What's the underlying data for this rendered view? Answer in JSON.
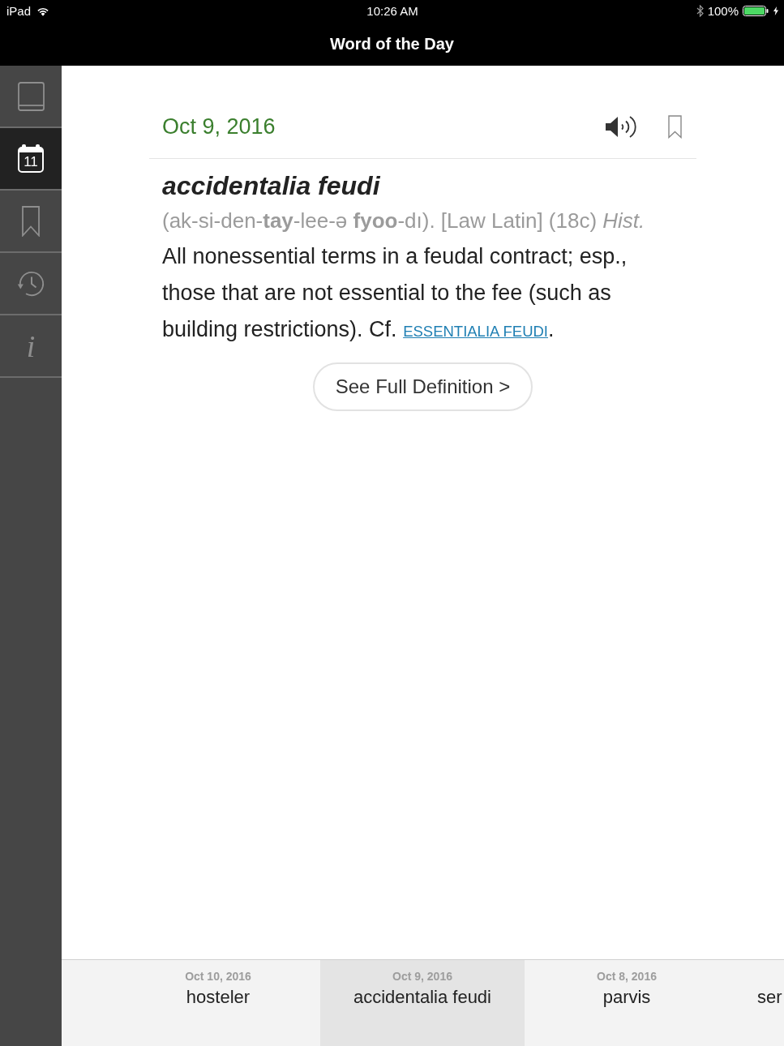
{
  "status_bar": {
    "carrier": "iPad",
    "time": "10:26 AM",
    "battery": "100%"
  },
  "nav_bar": {
    "title": "Word of the Day"
  },
  "sidebar": {
    "items": [
      {
        "kind": "book",
        "selected": false
      },
      {
        "kind": "calendar",
        "selected": true,
        "label": "11"
      },
      {
        "kind": "bookmark",
        "selected": false
      },
      {
        "kind": "history",
        "selected": false
      },
      {
        "kind": "info",
        "selected": false,
        "label": "i"
      }
    ]
  },
  "entry": {
    "date": "Oct 9, 2016",
    "bookmarked": false,
    "headword": "accidentalia feudi",
    "pronunciation": "(ak-si-den-**tay**-lee-ə **fyoo**-dı). [Law Latin] (18c) *Hist.*",
    "definition": "All nonessential terms in a feudal contract; esp., those that are not essential to the fee (such as building restrictions). Cf.",
    "cross_reference": "ESSENTIALIA FEUDI",
    "definition_end": ".",
    "button": "See Full Definition >"
  },
  "recent_words": [
    {
      "date": "Oct 10, 2016",
      "word": "hosteler",
      "selected": false
    },
    {
      "date": "Oct 9, 2016",
      "word": "accidentalia feudi",
      "selected": true
    },
    {
      "date": "Oct 8, 2016",
      "word": "parvis",
      "selected": false
    },
    {
      "word": "ser",
      "selected": false
    }
  ]
}
